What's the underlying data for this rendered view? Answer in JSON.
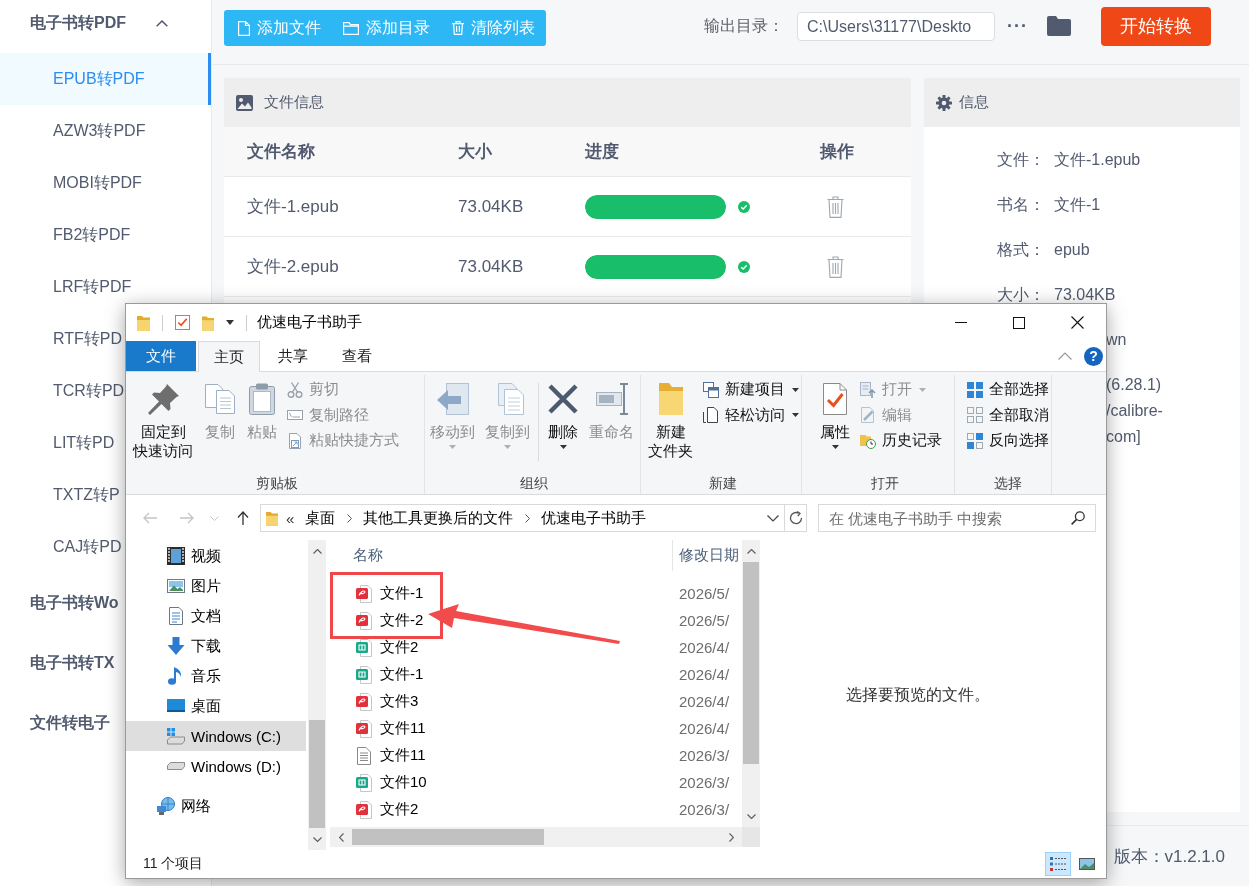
{
  "sidebar": {
    "groups": [
      {
        "label": "电子书转PDF",
        "expanded": true,
        "items": [
          {
            "label": "EPUB转PDF",
            "selected": true
          },
          {
            "label": "AZW3转PDF",
            "selected": false
          },
          {
            "label": "MOBI转PDF",
            "selected": false
          },
          {
            "label": "FB2转PDF",
            "selected": false
          },
          {
            "label": "LRF转PDF",
            "selected": false
          },
          {
            "label": "RTF转PD",
            "selected": false
          },
          {
            "label": "TCR转PD",
            "selected": false
          },
          {
            "label": "LIT转PD",
            "selected": false
          },
          {
            "label": "TXTZ转P",
            "selected": false
          },
          {
            "label": "CAJ转PD",
            "selected": false
          }
        ]
      },
      {
        "label": "电子书转Wo",
        "expanded": false
      },
      {
        "label": "电子书转TX",
        "expanded": false
      },
      {
        "label": "文件转电子",
        "expanded": false
      }
    ]
  },
  "toolbar": {
    "buttons": [
      "添加文件",
      "添加目录",
      "清除列表"
    ],
    "output_label": "输出目录：",
    "output_path": "C:\\Users\\31177\\Deskto",
    "more_button": "···",
    "start_button": "开始转换"
  },
  "file_panel": {
    "title": "文件信息",
    "columns": [
      "文件名称",
      "大小",
      "进度",
      "操作"
    ],
    "rows": [
      {
        "name": "文件-1.epub",
        "size": "73.04KB",
        "level": 1,
        "done": true
      },
      {
        "name": "文件-2.epub",
        "size": "73.04KB",
        "level": 1,
        "done": true
      }
    ]
  },
  "info_panel": {
    "title": "信息",
    "rows": [
      {
        "label": "文件：",
        "value": "文件-1.epub"
      },
      {
        "label": "书名：",
        "value": "文件-1"
      },
      {
        "label": "格式：",
        "value": "epub"
      },
      {
        "label": "大小：",
        "value": "73.04KB"
      },
      {
        "value": "wn"
      },
      {
        "value": "(6.28.1)\n/calibre-\ncom]"
      }
    ]
  },
  "version": "版本：v1.2.1.0",
  "explorer": {
    "title": "优速电子书助手",
    "ribbon_tabs": [
      {
        "label": "文件",
        "kind": "menu",
        "selected": false
      },
      {
        "label": "主页",
        "kind": "tab",
        "selected": true
      },
      {
        "label": "共享",
        "kind": "tab",
        "selected": false
      },
      {
        "label": "查看",
        "kind": "tab",
        "selected": false
      }
    ],
    "help_button": "?",
    "ribbon_groups": [
      {
        "label": "剪贴板",
        "commands": [
          {
            "label": "固定到快速访问",
            "kind": "large",
            "disabled": false,
            "dropdown": false
          },
          {
            "label": "复制",
            "kind": "large",
            "disabled": true,
            "dropdown": false
          },
          {
            "label": "粘贴",
            "kind": "large",
            "disabled": true,
            "dropdown": false
          },
          {
            "label": "剪切",
            "kind": "small",
            "disabled": true,
            "dropdown": false
          },
          {
            "label": "复制路径",
            "kind": "small",
            "disabled": true,
            "dropdown": false
          },
          {
            "label": "粘贴快捷方式",
            "kind": "small",
            "disabled": true,
            "dropdown": false
          }
        ]
      },
      {
        "label": "组织",
        "commands": [
          {
            "label": "移动到",
            "kind": "large",
            "disabled": true,
            "dropdown": true
          },
          {
            "label": "复制到",
            "kind": "large",
            "disabled": true,
            "dropdown": true
          },
          {
            "kind": "separator"
          },
          {
            "label": "删除",
            "kind": "large",
            "disabled": false,
            "dropdown": true
          },
          {
            "label": "重命名",
            "kind": "large",
            "disabled": true,
            "dropdown": false
          }
        ]
      },
      {
        "label": "新建",
        "commands": [
          {
            "label": "新建文件夹",
            "kind": "large",
            "disabled": false,
            "dropdown": false
          },
          {
            "label": "新建项目",
            "kind": "small",
            "disabled": false,
            "dropdown": true
          },
          {
            "label": "轻松访问",
            "kind": "small",
            "disabled": false,
            "dropdown": true
          }
        ]
      },
      {
        "label": "打开",
        "commands": [
          {
            "label": "属性",
            "kind": "large",
            "disabled": false,
            "dropdown": true
          },
          {
            "label": "打开",
            "kind": "small",
            "disabled": true,
            "dropdown": true
          },
          {
            "label": "编辑",
            "kind": "small",
            "disabled": true,
            "dropdown": false
          },
          {
            "label": "历史记录",
            "kind": "small",
            "disabled": false,
            "dropdown": false
          }
        ]
      },
      {
        "label": "选择",
        "commands": [
          {
            "label": "全部选择",
            "kind": "small",
            "disabled": false,
            "dropdown": false
          },
          {
            "label": "全部取消",
            "kind": "small",
            "disabled": false,
            "dropdown": false
          },
          {
            "label": "反向选择",
            "kind": "small",
            "disabled": false,
            "dropdown": false
          }
        ]
      }
    ],
    "nav_buttons": [
      {
        "disabled": true
      },
      {
        "disabled": true
      },
      {
        "disabled": true
      },
      {
        "disabled": false
      }
    ],
    "address": {
      "overflow": "«",
      "crumbs": [
        "桌面",
        "其他工具更换后的文件",
        "优速电子书助手"
      ]
    },
    "search_placeholder": "在 优速电子书助手 中搜索",
    "nav_items": [
      {
        "label": "视频",
        "selected": false
      },
      {
        "label": "图片",
        "selected": false
      },
      {
        "label": "文档",
        "selected": false
      },
      {
        "label": "下载",
        "selected": false
      },
      {
        "label": "音乐",
        "selected": false
      },
      {
        "label": "桌面",
        "selected": false
      },
      {
        "label": "Windows (C:)",
        "selected": true
      },
      {
        "label": "Windows (D:)",
        "selected": false
      }
    ],
    "nav_root_items": [
      {
        "label": "网络",
        "selected": false
      }
    ],
    "columns": [
      "名称",
      "修改日期"
    ],
    "files": [
      {
        "name": "文件-1",
        "kind": "pdf",
        "date": "2026/5/",
        "highlighted": true
      },
      {
        "name": "文件-2",
        "kind": "pdf",
        "date": "2026/5/",
        "highlighted": true
      },
      {
        "name": "文件2",
        "kind": "ebook",
        "date": "2026/4/",
        "highlighted": false
      },
      {
        "name": "文件-1",
        "kind": "ebook",
        "date": "2026/4/",
        "highlighted": false
      },
      {
        "name": "文件3",
        "kind": "pdf",
        "date": "2026/4/",
        "highlighted": false
      },
      {
        "name": "文件11",
        "kind": "pdf",
        "date": "2026/4/",
        "highlighted": false
      },
      {
        "name": "文件11",
        "kind": "text",
        "date": "2026/3/",
        "highlighted": false
      },
      {
        "name": "文件10",
        "kind": "ebook",
        "date": "2026/3/",
        "highlighted": false
      },
      {
        "name": "文件2",
        "kind": "pdf",
        "date": "2026/3/",
        "highlighted": false
      }
    ],
    "preview_text": "选择要预览的文件。",
    "status_text": "11 个项目",
    "view_buttons": [
      {
        "selected": true
      },
      {
        "selected": false
      }
    ]
  }
}
